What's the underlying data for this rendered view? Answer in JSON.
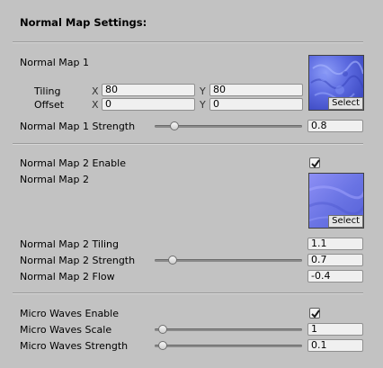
{
  "header": {
    "title": "Normal Map Settings:"
  },
  "nm1": {
    "label": "Normal Map 1",
    "tiling_label": "Tiling",
    "offset_label": "Offset",
    "x_label": "X",
    "y_label": "Y",
    "tiling_x": "80",
    "tiling_y": "80",
    "offset_x": "0",
    "offset_y": "0",
    "select_label": "Select",
    "strength_label": "Normal Map 1 Strength",
    "strength_value": "0.8",
    "strength_fraction": 0.08
  },
  "nm2": {
    "enable_label": "Normal Map 2 Enable",
    "enable_checked": true,
    "label": "Normal Map 2",
    "select_label": "Select",
    "tiling_label": "Normal Map 2 Tiling",
    "tiling_value": "1.1",
    "strength_label": "Normal Map 2 Strength",
    "strength_value": "0.7",
    "strength_fraction": 0.07,
    "flow_label": "Normal Map 2 Flow",
    "flow_value": "-0.4"
  },
  "micro": {
    "enable_label": "Micro Waves Enable",
    "enable_checked": true,
    "scale_label": "Micro Waves Scale",
    "scale_value": "1",
    "scale_fraction": 0.0,
    "strength_label": "Micro Waves Strength",
    "strength_value": "0.1",
    "strength_fraction": 0.0
  },
  "colors": {
    "background": "#c2c2c2",
    "normal_map_base": "#5e6ce0"
  }
}
